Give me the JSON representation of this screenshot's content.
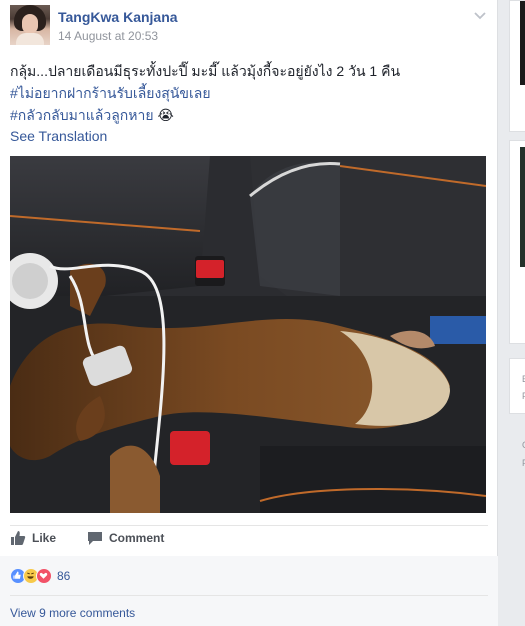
{
  "post": {
    "author": "TangKwa Kanjana",
    "timestamp": "14 August at 20:53",
    "text_line": "กลุ้ม...ปลายเดือนมีธุระทั้งปะปี๊ มะมี๊ แล้วมุ้งกี้จะอยู่ยังไง 2 วัน 1 คืน",
    "hashtags": [
      "#ไม่อยากฝากร้านรับเลี้ยงสุนัขเลย",
      "#กลัวกลับมาแล้วลูกหาย"
    ],
    "hashtag_emoji": "😭",
    "see_translation": "See Translation",
    "photo_subject": "otter-in-car-console"
  },
  "actions": {
    "like_label": "Like",
    "comment_label": "Comment"
  },
  "reactions": {
    "count": "86",
    "types": [
      "like",
      "haha",
      "love"
    ]
  },
  "comments": {
    "view_more": "View 9 more comments"
  },
  "sidebar": {
    "letters": [
      "E",
      "F",
      "C",
      "F"
    ]
  },
  "colors": {
    "link": "#365899",
    "muted": "#90949c",
    "bg": "#e9ebee",
    "like": "#5890ff",
    "haha": "#f7c94a",
    "love": "#f25268"
  },
  "icons": [
    "chevron-down-icon",
    "thumbs-up-icon",
    "comment-icon",
    "like-reaction-icon",
    "haha-reaction-icon",
    "love-reaction-icon"
  ]
}
